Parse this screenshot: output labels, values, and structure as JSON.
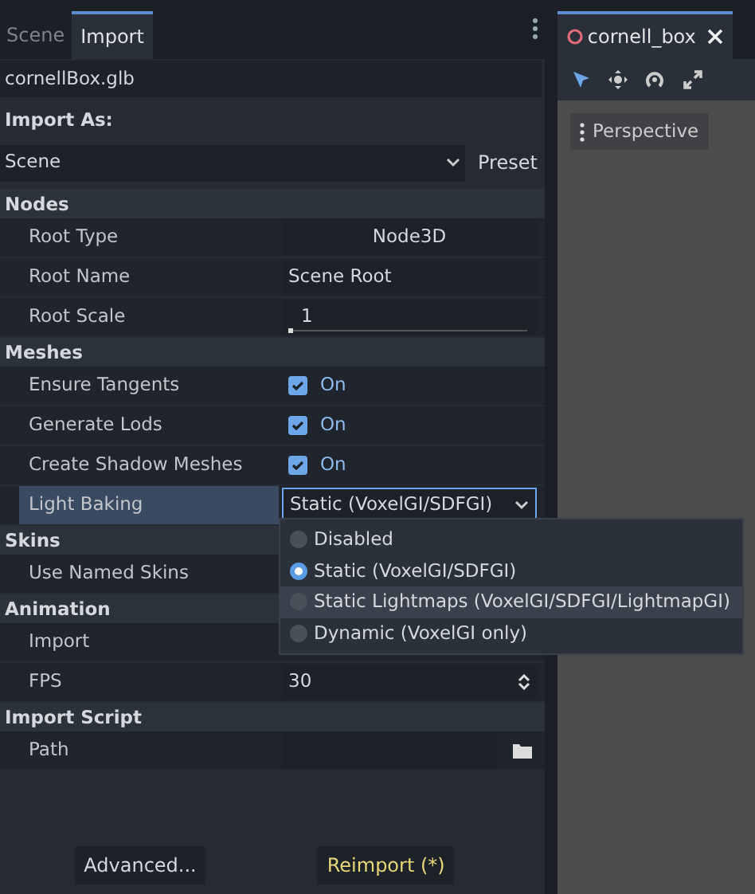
{
  "left_tabs": [
    {
      "label": "Scene",
      "selected": false
    },
    {
      "label": "Import",
      "selected": true
    }
  ],
  "file": "cornellBox.glb",
  "import_as": {
    "label": "Import As:",
    "value": "Scene",
    "preset": "Preset"
  },
  "sections": [
    {
      "title": "Nodes",
      "properties": [
        {
          "label": "Root Type",
          "kind": "button",
          "value": "Node3D",
          "selected": false
        },
        {
          "label": "Root Name",
          "kind": "text",
          "value": "Scene Root",
          "selected": false
        },
        {
          "label": "Root Scale",
          "kind": "slider",
          "value": "1",
          "level": 0.0,
          "selected": false
        }
      ]
    },
    {
      "title": "Meshes",
      "properties": [
        {
          "label": "Ensure Tangents",
          "kind": "check",
          "checked": true,
          "value": "On",
          "selected": false
        },
        {
          "label": "Generate Lods",
          "kind": "check",
          "checked": true,
          "value": "On",
          "selected": false
        },
        {
          "label": "Create Shadow Meshes",
          "kind": "check",
          "checked": true,
          "value": "On",
          "selected": false
        },
        {
          "label": "Light Baking",
          "kind": "dropdown",
          "value": "Static (VoxelGI/SDFGI)",
          "selected": true
        }
      ]
    },
    {
      "title": "Skins",
      "properties": [
        {
          "label": "Use Named Skins",
          "kind": "covered",
          "selected": false
        }
      ]
    },
    {
      "title": "Animation",
      "properties": [
        {
          "label": "Import",
          "kind": "covered",
          "selected": false
        },
        {
          "label": "FPS",
          "kind": "spin",
          "value": "30",
          "selected": false
        }
      ]
    },
    {
      "title": "Import Script",
      "properties": [
        {
          "label": "Path",
          "kind": "file",
          "selected": false
        }
      ]
    }
  ],
  "popup": {
    "options": [
      {
        "label": "Disabled",
        "selected": false,
        "hovered": false
      },
      {
        "label": "Static (VoxelGI/SDFGI)",
        "selected": true,
        "hovered": false
      },
      {
        "label": "Static Lightmaps (VoxelGI/SDFGI/LightmapGI)",
        "selected": false,
        "hovered": true
      },
      {
        "label": "Dynamic (VoxelGI only)",
        "selected": false,
        "hovered": false
      }
    ]
  },
  "buttons": [
    {
      "label": "Advanced...",
      "kind": "normal"
    },
    {
      "label": "Reimport (*)",
      "kind": "warning"
    }
  ],
  "right_tab": {
    "label": "cornell_box",
    "selected": true
  },
  "view_menu": "Perspective"
}
